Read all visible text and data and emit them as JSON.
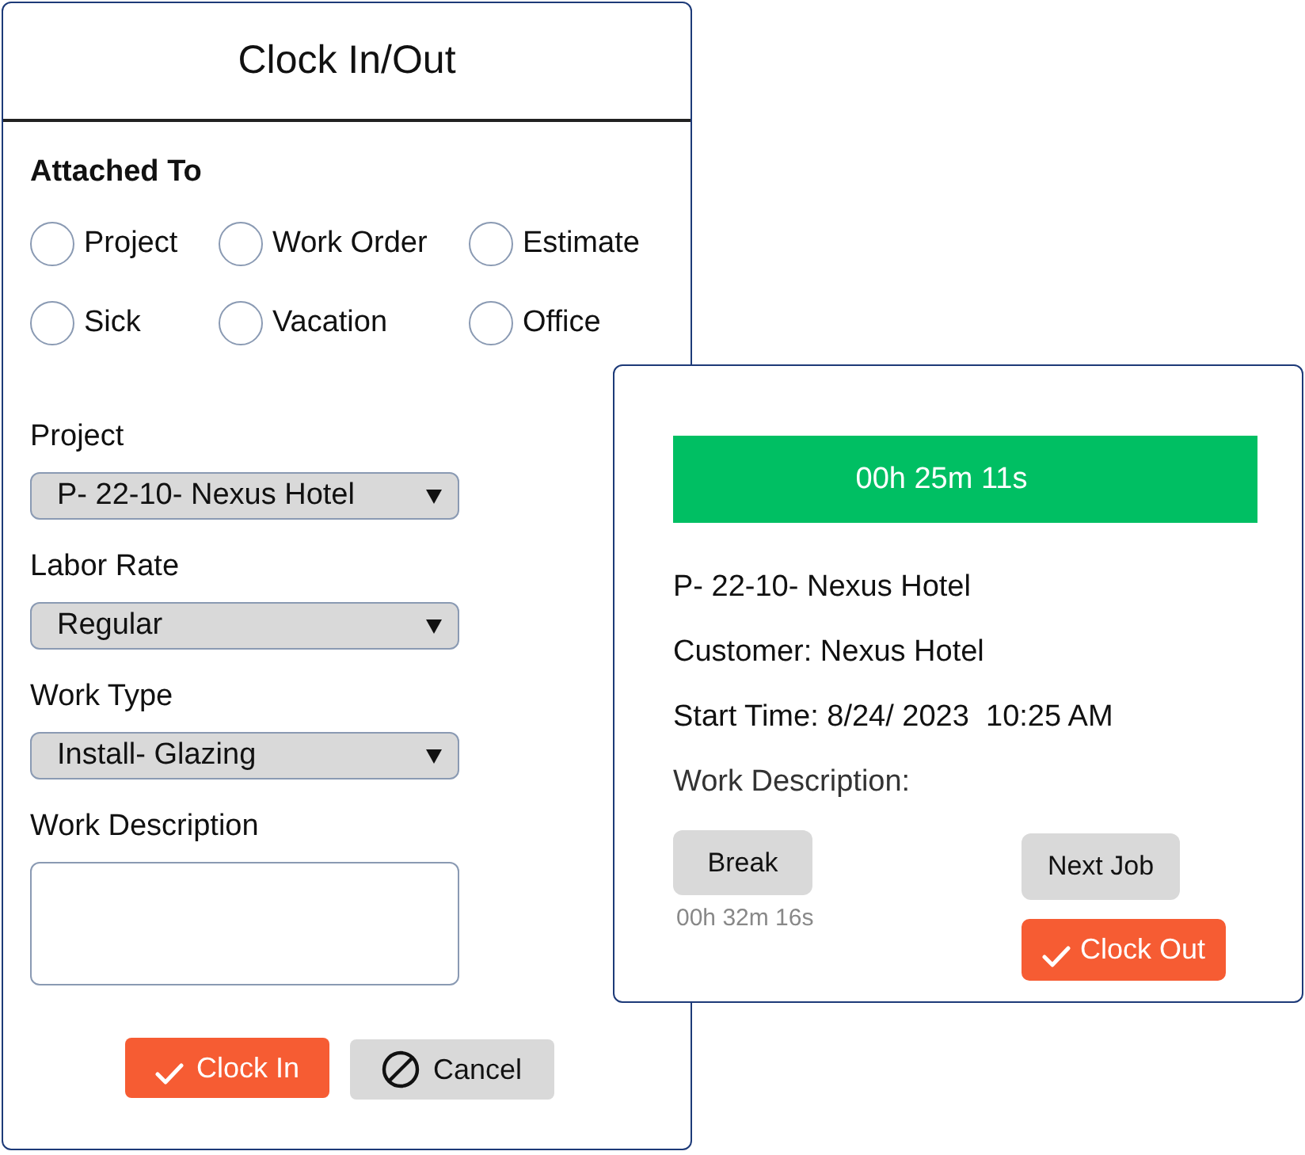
{
  "dialog": {
    "title": "Clock In/Out",
    "attached_to": {
      "label": "Attached To",
      "options": [
        {
          "label": "Project",
          "selected": false
        },
        {
          "label": "Work Order",
          "selected": false
        },
        {
          "label": "Estimate",
          "selected": false
        },
        {
          "label": "Sick",
          "selected": false
        },
        {
          "label": "Vacation",
          "selected": false
        },
        {
          "label": "Office",
          "selected": false
        }
      ]
    },
    "fields": [
      {
        "kind": "select",
        "label": "Project",
        "value": "P- 22-10- Nexus Hotel"
      },
      {
        "kind": "select",
        "label": "Labor Rate",
        "value": "Regular"
      },
      {
        "kind": "select",
        "label": "Work Type",
        "value": "Install- Glazing"
      },
      {
        "kind": "textarea",
        "label": "Work Description"
      }
    ],
    "buttons": [
      {
        "kind": "primary",
        "label": "Clock In"
      },
      {
        "kind": "secondary",
        "label": "Cancel"
      }
    ]
  },
  "timer_card": {
    "elapsed": "00h 25m 11s",
    "project": "P- 22-10- Nexus Hotel",
    "customer": "Customer: Nexus Hotel",
    "start_time": "Start Time: 8/24/ 2023  10:25 AM",
    "work_description": "Work Description:",
    "break_button": "Break",
    "break_elapsed": "00h 32m 16s",
    "next_job_button": "Next Job",
    "clock_out_button": "Clock Out"
  }
}
